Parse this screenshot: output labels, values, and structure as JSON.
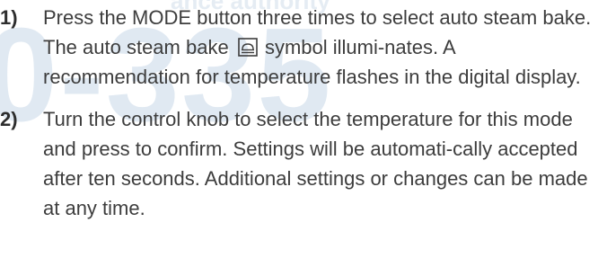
{
  "watermark": {
    "top_text": "ance authority",
    "big_text": "0-335"
  },
  "steps": [
    {
      "number": "1)",
      "text_before_icon": "Press the MODE button three times to select auto steam bake. The auto steam bake",
      "icon": "auto-steam-bake-symbol-icon",
      "text_after_icon": "symbol illumi-nates. A recommendation for temperature flashes in the digital display."
    },
    {
      "number": "2)",
      "text": "Turn the control knob to select the temperature for this mode and press to confirm. Settings will be automati-cally accepted after ten seconds. Additional settings or changes can be made at any time."
    }
  ]
}
